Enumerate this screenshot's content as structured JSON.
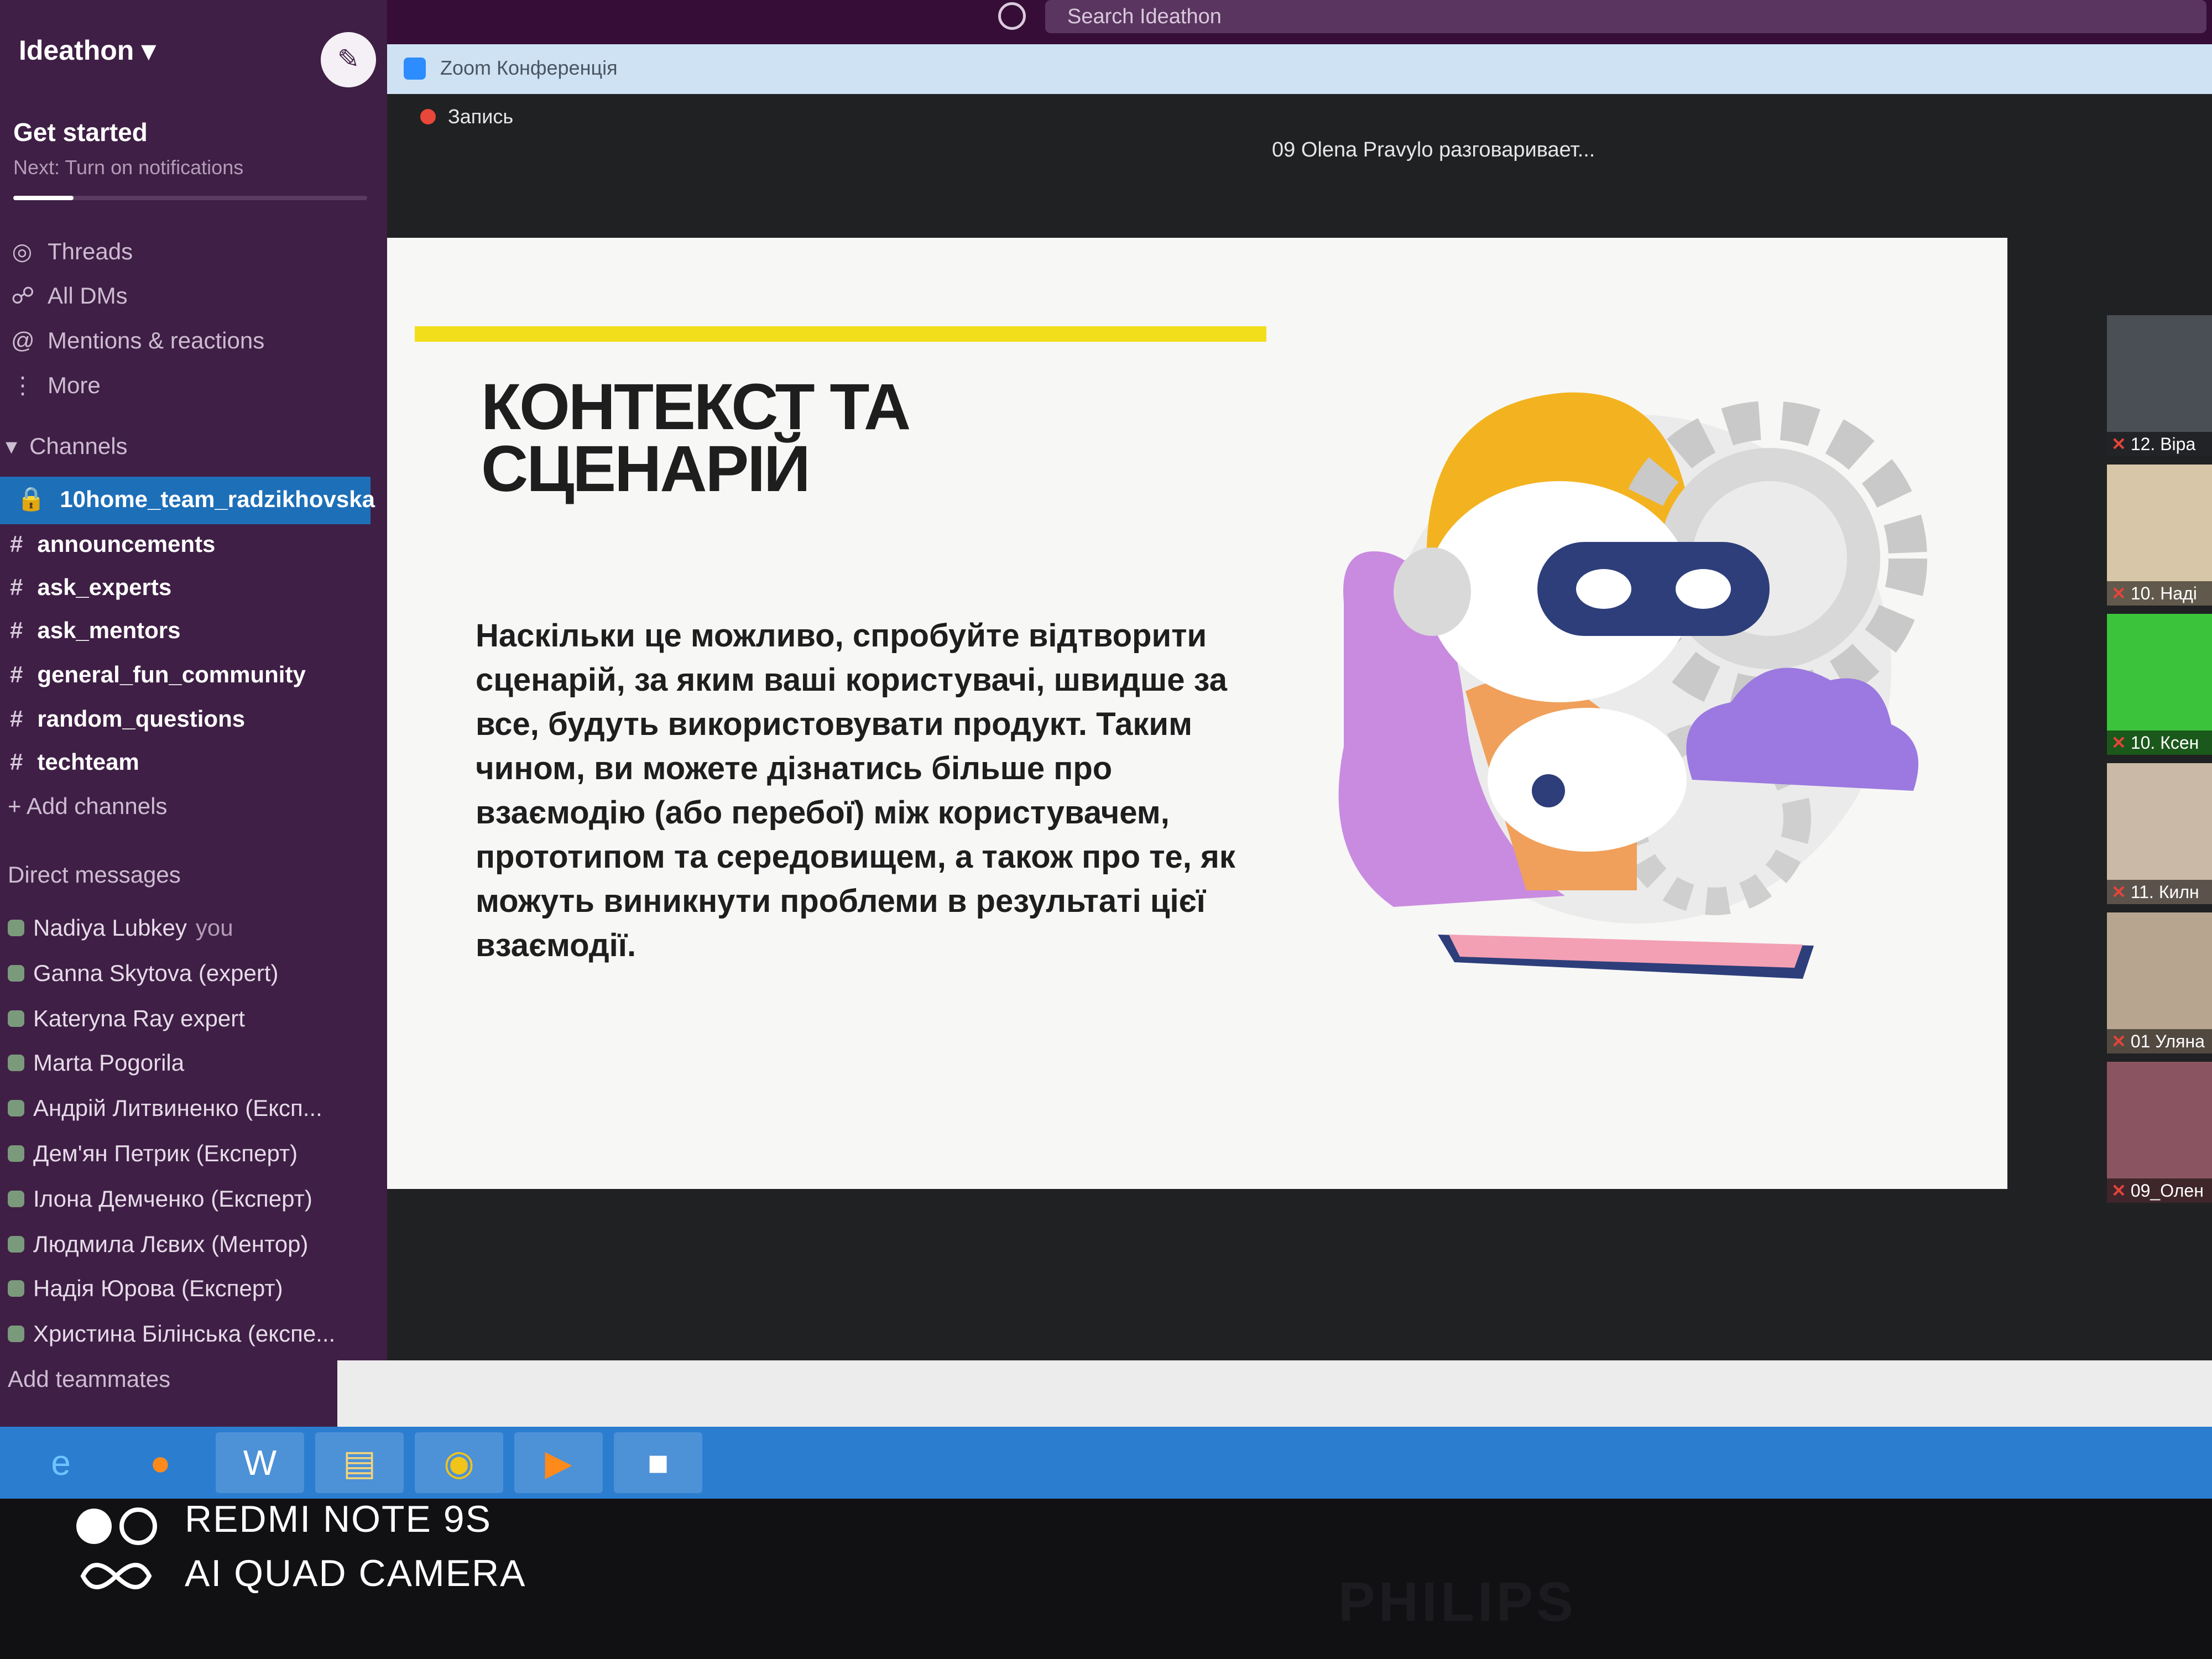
{
  "slack": {
    "workspace": "Ideathon",
    "search_placeholder": "Search Ideathon",
    "get_started": "Get started",
    "next_hint": "Next: Turn on notifications",
    "nav": [
      {
        "icon": "threads-icon",
        "label": "Threads"
      },
      {
        "icon": "dms-icon",
        "label": "All DMs"
      },
      {
        "icon": "mentions-icon",
        "label": "Mentions & reactions"
      },
      {
        "icon": "more-icon",
        "label": "More"
      }
    ],
    "channels_header": "Channels",
    "active_channel": "10home_team_radzikhovska",
    "channels": [
      "announcements",
      "ask_experts",
      "ask_mentors",
      "general_fun_community",
      "random_questions",
      "techteam"
    ],
    "add_channels": "Add channels",
    "dm_header": "Direct messages",
    "dms": [
      {
        "name": "Nadiya Lubkey",
        "tag": "you"
      },
      {
        "name": "Ganna Skytova (expert)",
        "tag": ""
      },
      {
        "name": "Kateryna Ray expert",
        "tag": ""
      },
      {
        "name": "Marta Pogorila",
        "tag": ""
      },
      {
        "name": "Андрій Литвиненко (Експ...",
        "tag": ""
      },
      {
        "name": "Дем'ян Петрик (Експерт)",
        "tag": ""
      },
      {
        "name": "Ілона Демченко (Експерт)",
        "tag": ""
      },
      {
        "name": "Людмила Лєвих (Ментор)",
        "tag": ""
      },
      {
        "name": "Надія Юрова (Експерт)",
        "tag": ""
      },
      {
        "name": "Христина Білінська (експе...",
        "tag": ""
      }
    ],
    "add_teammates": "Add teammates",
    "onboarding_progress": 0.17
  },
  "zoom": {
    "window_title": "Zoom Конференція",
    "recording_label": "Запись",
    "speaker_status": "09 Olena Pravylo разговаривает...",
    "participants": [
      "12. Віра",
      "10. Наді",
      "10. Ксен",
      "11. Килн",
      "01 Уляна",
      "09_Олен"
    ]
  },
  "slide": {
    "title_line1": "КОНТЕКСТ ТА",
    "title_line2": "СЦЕНАРІЙ",
    "body": "Наскільки це можливо, спробуйте відтворити сценарій, за яким ваші користувачі, швидше за все, будуть використовувати продукт. Таким чином, ви можете дізнатись більше про взаємодію (або перебої) між користувачем, прототипом та середовищем, а також про те, як можуть виникнути проблеми в результаті цієї взаємодії."
  },
  "taskbar": {
    "apps": [
      "ie-icon",
      "firefox-icon",
      "word-icon",
      "explorer-icon",
      "chrome-icon",
      "media-player-icon",
      "zoom-icon"
    ]
  },
  "camera_watermark": {
    "line1": "REDMI NOTE 9S",
    "line2": "AI QUAD CAMERA"
  },
  "monitor_brand": "PHILIPS",
  "colors": {
    "slack_sidebar": "#3f1f45",
    "active_channel": "#1d6fb8",
    "slide_accent": "#f2de1b",
    "taskbar": "#2b7dd0"
  }
}
